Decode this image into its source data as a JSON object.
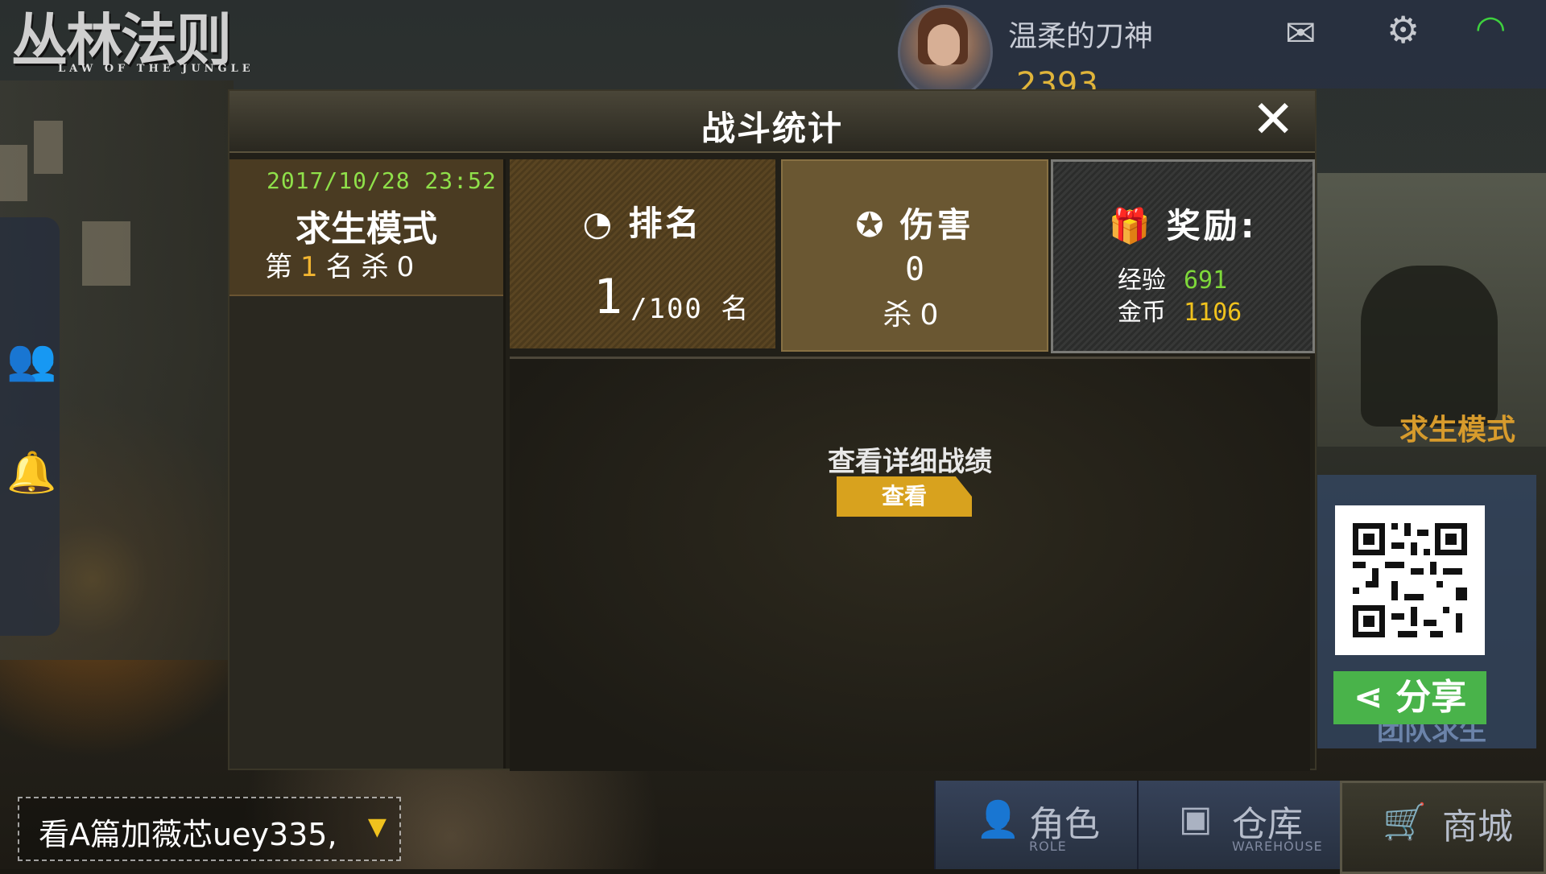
{
  "logo": {
    "title": "丛林法则",
    "subtitle": "LAW OF THE JUNGLE"
  },
  "profile": {
    "username": "温柔的刀神",
    "coins": "2393"
  },
  "topbar_icons": [
    "mail-icon",
    "gear-icon",
    "wifi-icon"
  ],
  "dialog": {
    "title": "战斗统计",
    "close_label": "✕",
    "match": {
      "date": "2017/10/28 23:52",
      "mode": "求生模式",
      "rank_prefix": "第",
      "rank": "1",
      "rank_suffix": "名",
      "kill_label": "杀",
      "kills": "0"
    },
    "rank_box": {
      "label": "排名",
      "rank": "1",
      "total": "/100 名"
    },
    "damage_box": {
      "label": "伤害",
      "damage": "0",
      "kill_label": "杀",
      "kills": "0"
    },
    "reward_box": {
      "label": "奖励:",
      "exp_label": "经验",
      "exp": "691",
      "gold_label": "金币",
      "gold": "1106"
    },
    "detail": {
      "label": "查看详细战绩",
      "button": "查看"
    }
  },
  "right_panel": {
    "mode_label": "求生模式",
    "share_label": "分享",
    "team_label": "团队求生"
  },
  "chat": {
    "text": "看A篇加薇芯uey335,"
  },
  "bottom_nav": [
    {
      "cn": "角色",
      "en": "ROLE",
      "icon": "person-icon"
    },
    {
      "cn": "仓库",
      "en": "WAREHOUSE",
      "icon": "box-icon"
    },
    {
      "cn": "商城",
      "en": "",
      "icon": "cart-icon"
    }
  ],
  "colors": {
    "accent_gold": "#f2b531",
    "accent_green": "#7ed83a",
    "share_green": "#49b34a",
    "button_gold": "#d8a21e"
  }
}
